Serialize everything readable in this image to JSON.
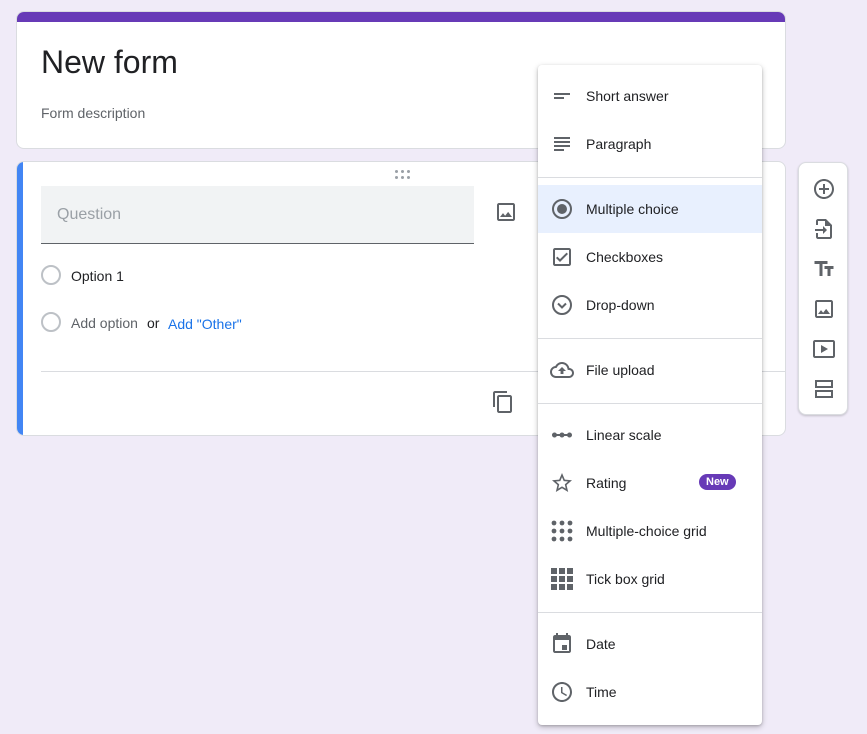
{
  "form": {
    "title": "New form",
    "description": "Form description"
  },
  "question": {
    "placeholder": "Question",
    "option1": "Option 1",
    "add_option": "Add option",
    "or": "or",
    "add_other": "Add \"Other\""
  },
  "type_menu": {
    "items": [
      {
        "label": "Short answer",
        "icon": "short-text-icon"
      },
      {
        "label": "Paragraph",
        "icon": "paragraph-icon"
      },
      {
        "label": "Multiple choice",
        "icon": "radio-button-icon",
        "selected": true
      },
      {
        "label": "Checkboxes",
        "icon": "checkbox-icon"
      },
      {
        "label": "Drop-down",
        "icon": "dropdown-circle-icon"
      },
      {
        "label": "File upload",
        "icon": "cloud-upload-icon"
      },
      {
        "label": "Linear scale",
        "icon": "linear-scale-icon"
      },
      {
        "label": "Rating",
        "icon": "star-icon",
        "badge": "New"
      },
      {
        "label": "Multiple-choice grid",
        "icon": "dot-grid-icon"
      },
      {
        "label": "Tick box grid",
        "icon": "square-grid-icon"
      },
      {
        "label": "Date",
        "icon": "calendar-icon"
      },
      {
        "label": "Time",
        "icon": "clock-icon"
      }
    ]
  },
  "side_toolbar": {
    "buttons": [
      "add-question-icon",
      "import-questions-icon",
      "add-title-icon",
      "add-image-icon",
      "add-video-icon",
      "add-section-icon"
    ]
  },
  "colors": {
    "theme": "#673ab7",
    "active_accent": "#4285f4",
    "background": "#f0ebf8",
    "link": "#1a73e8",
    "selected_item": "#e8f0fe"
  }
}
